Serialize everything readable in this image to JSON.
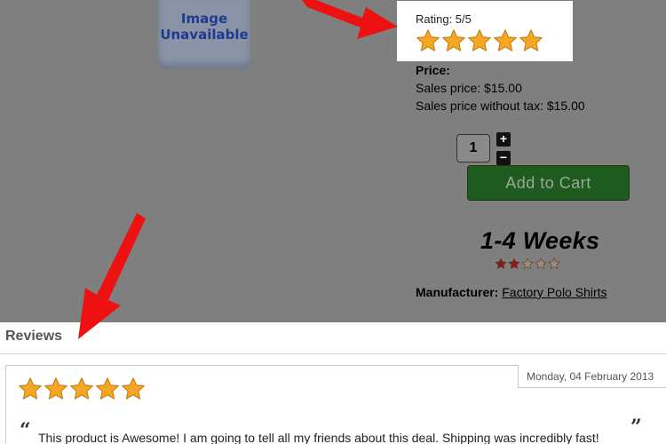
{
  "product": {
    "image_placeholder_line1": "Image",
    "image_placeholder_line2": "Unavailable",
    "rating_label": "Rating: 5/5",
    "rating_value": 5,
    "rating_max": 5,
    "price_heading": "Price:",
    "sales_price": "Sales price: $15.00",
    "sales_price_without_tax": "Sales price without tax: $15.00",
    "quantity": "1",
    "increment_symbol": "+",
    "decrement_symbol": "−",
    "add_to_cart_label": "Add to Cart",
    "ship_time": "1-4 Weeks",
    "ship_stars_filled": 2,
    "ship_stars_max": 5,
    "manufacturer_label": "Manufacturer:",
    "manufacturer_name": "Factory Polo Shirts"
  },
  "reviews": {
    "heading": "Reviews",
    "items": [
      {
        "date": "Monday, 04 February 2013",
        "rating": 5,
        "rating_max": 5,
        "open_quote": "“",
        "close_quote": "”",
        "text": "This product is Awesome! I am going to tell all my friends about this deal. Shipping was incredibly fast!"
      }
    ]
  },
  "colors": {
    "overlay_gray": "#7f7f7f",
    "star_gold": "#f5a623",
    "arrow_red": "#ee1111",
    "cart_green": "#1f5a1f",
    "ship_star_red": "#8b1a1a",
    "ship_star_empty": "#9a8f7a"
  },
  "icons": {
    "rating_star": "star-icon",
    "annotation_arrow": "red-arrow-icon"
  }
}
